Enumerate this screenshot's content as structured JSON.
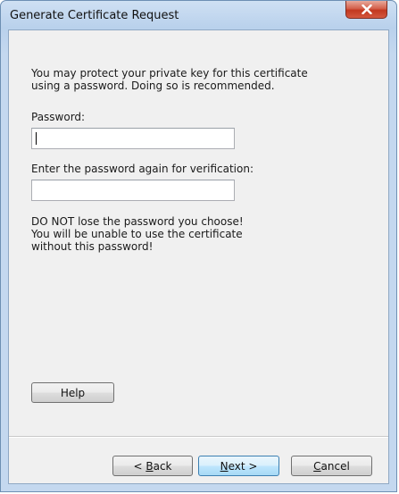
{
  "window": {
    "title": "Generate Certificate Request"
  },
  "intro": {
    "line1": "You may protect your private key for this certificate",
    "line2": "using a password. Doing so is recommended."
  },
  "password_field": {
    "label": "Password:",
    "value": ""
  },
  "confirm_field": {
    "label": "Enter the password again for verification:",
    "value": ""
  },
  "warning": {
    "line1": "DO NOT lose the password you choose!",
    "line2": "You will be unable to use the certificate",
    "line3": "without this password!"
  },
  "buttons": {
    "help": "Help",
    "back_prefix": "< ",
    "back_access": "B",
    "back_rest": "ack",
    "next_access": "N",
    "next_rest": "ext >",
    "cancel_access": "C",
    "cancel_rest": "ancel"
  },
  "icons": {
    "close": "close-x-icon"
  },
  "colors": {
    "client_bg": "#f0f0f0",
    "close_button": "#c2381f",
    "default_button_border": "#3c7fb1"
  }
}
